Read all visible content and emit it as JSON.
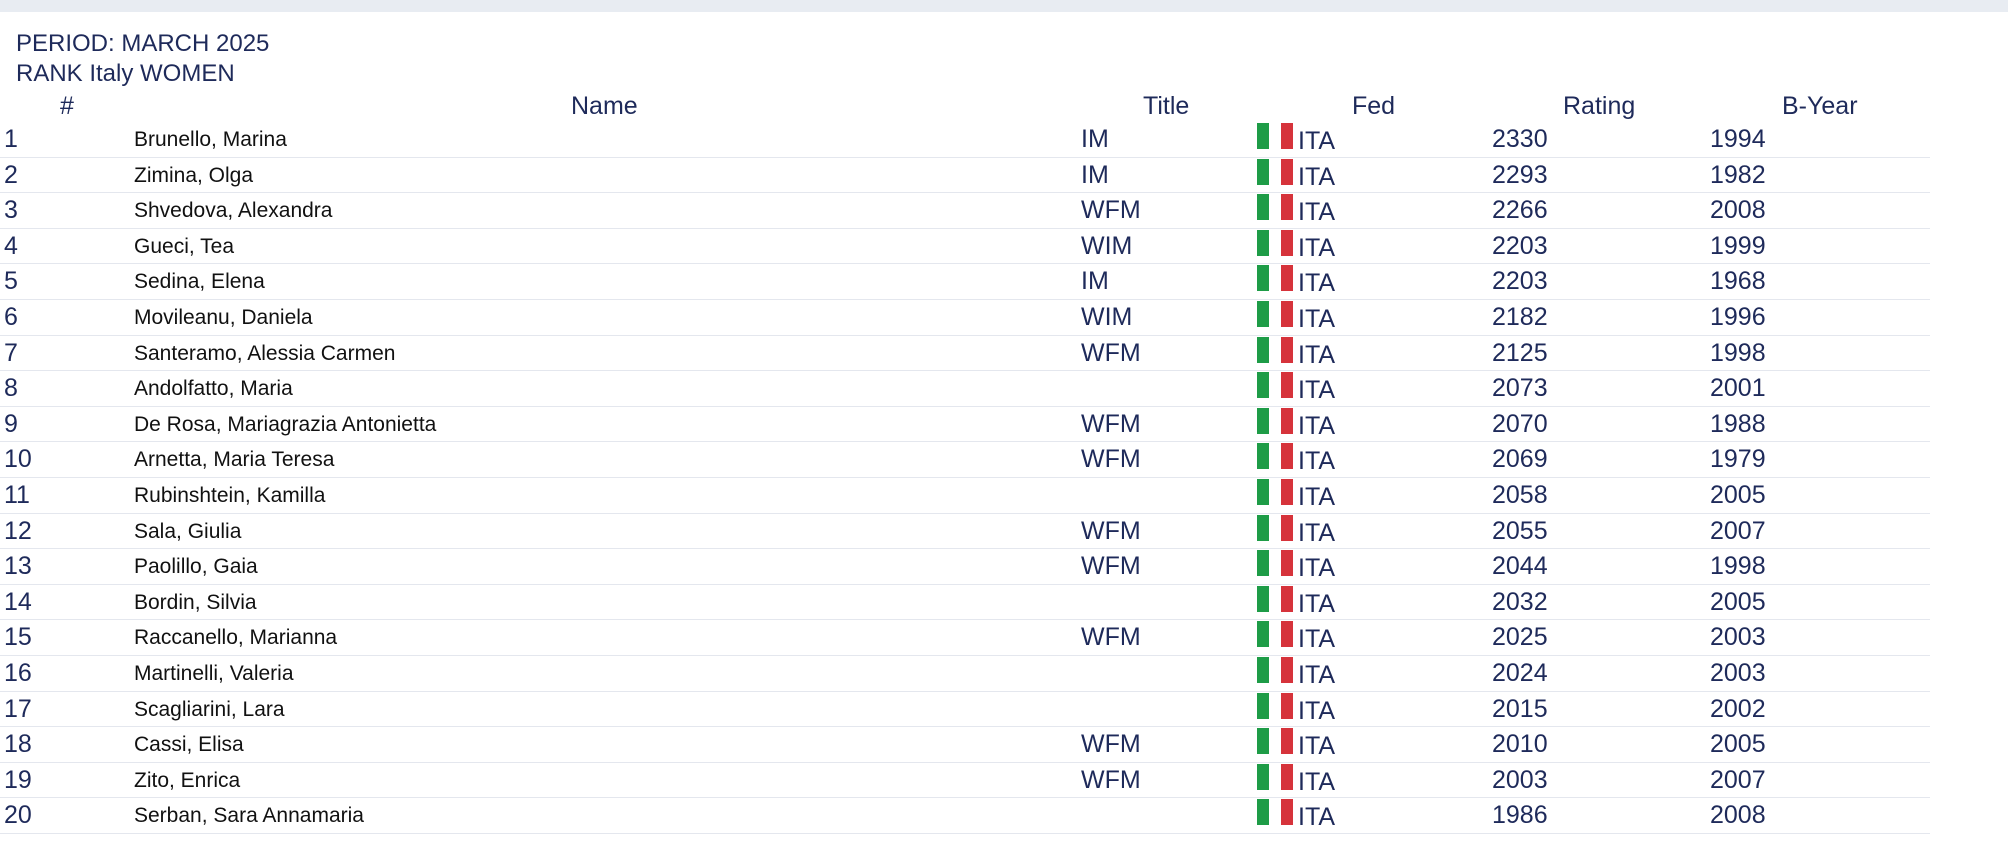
{
  "period_label": "PERIOD: MARCH 2025",
  "rank_label": "RANK Italy WOMEN",
  "columns": {
    "num": "#",
    "name": "Name",
    "title": "Title",
    "fed": "Fed",
    "rating": "Rating",
    "byear": "B-Year"
  },
  "colors": {
    "text_primary": "#1e2a5a",
    "flag_green": "#1e9c47",
    "flag_white": "#ffffff",
    "flag_red": "#d6333b"
  },
  "flag_icon": "italy-flag-icon",
  "rows": [
    {
      "num": "1",
      "name": "Brunello, Marina",
      "title": "IM",
      "fed": "ITA",
      "rating": "2330",
      "byear": "1994"
    },
    {
      "num": "2",
      "name": "Zimina, Olga",
      "title": "IM",
      "fed": "ITA",
      "rating": "2293",
      "byear": "1982"
    },
    {
      "num": "3",
      "name": "Shvedova, Alexandra",
      "title": "WFM",
      "fed": "ITA",
      "rating": "2266",
      "byear": "2008"
    },
    {
      "num": "4",
      "name": "Gueci, Tea",
      "title": "WIM",
      "fed": "ITA",
      "rating": "2203",
      "byear": "1999"
    },
    {
      "num": "5",
      "name": "Sedina, Elena",
      "title": "IM",
      "fed": "ITA",
      "rating": "2203",
      "byear": "1968"
    },
    {
      "num": "6",
      "name": "Movileanu, Daniela",
      "title": "WIM",
      "fed": "ITA",
      "rating": "2182",
      "byear": "1996"
    },
    {
      "num": "7",
      "name": "Santeramo, Alessia Carmen",
      "title": "WFM",
      "fed": "ITA",
      "rating": "2125",
      "byear": "1998"
    },
    {
      "num": "8",
      "name": "Andolfatto, Maria",
      "title": "",
      "fed": "ITA",
      "rating": "2073",
      "byear": "2001"
    },
    {
      "num": "9",
      "name": "De Rosa, Mariagrazia Antonietta",
      "title": "WFM",
      "fed": "ITA",
      "rating": "2070",
      "byear": "1988"
    },
    {
      "num": "10",
      "name": "Arnetta, Maria Teresa",
      "title": "WFM",
      "fed": "ITA",
      "rating": "2069",
      "byear": "1979"
    },
    {
      "num": "11",
      "name": "Rubinshtein, Kamilla",
      "title": "",
      "fed": "ITA",
      "rating": "2058",
      "byear": "2005"
    },
    {
      "num": "12",
      "name": "Sala, Giulia",
      "title": "WFM",
      "fed": "ITA",
      "rating": "2055",
      "byear": "2007"
    },
    {
      "num": "13",
      "name": "Paolillo, Gaia",
      "title": "WFM",
      "fed": "ITA",
      "rating": "2044",
      "byear": "1998"
    },
    {
      "num": "14",
      "name": "Bordin, Silvia",
      "title": "",
      "fed": "ITA",
      "rating": "2032",
      "byear": "2005"
    },
    {
      "num": "15",
      "name": "Raccanello, Marianna",
      "title": "WFM",
      "fed": "ITA",
      "rating": "2025",
      "byear": "2003"
    },
    {
      "num": "16",
      "name": "Martinelli, Valeria",
      "title": "",
      "fed": "ITA",
      "rating": "2024",
      "byear": "2003"
    },
    {
      "num": "17",
      "name": "Scagliarini, Lara",
      "title": "",
      "fed": "ITA",
      "rating": "2015",
      "byear": "2002"
    },
    {
      "num": "18",
      "name": "Cassi, Elisa",
      "title": "WFM",
      "fed": "ITA",
      "rating": "2010",
      "byear": "2005"
    },
    {
      "num": "19",
      "name": "Zito, Enrica",
      "title": "WFM",
      "fed": "ITA",
      "rating": "2003",
      "byear": "2007"
    },
    {
      "num": "20",
      "name": "Serban, Sara Annamaria",
      "title": "",
      "fed": "ITA",
      "rating": "1986",
      "byear": "2008"
    }
  ]
}
